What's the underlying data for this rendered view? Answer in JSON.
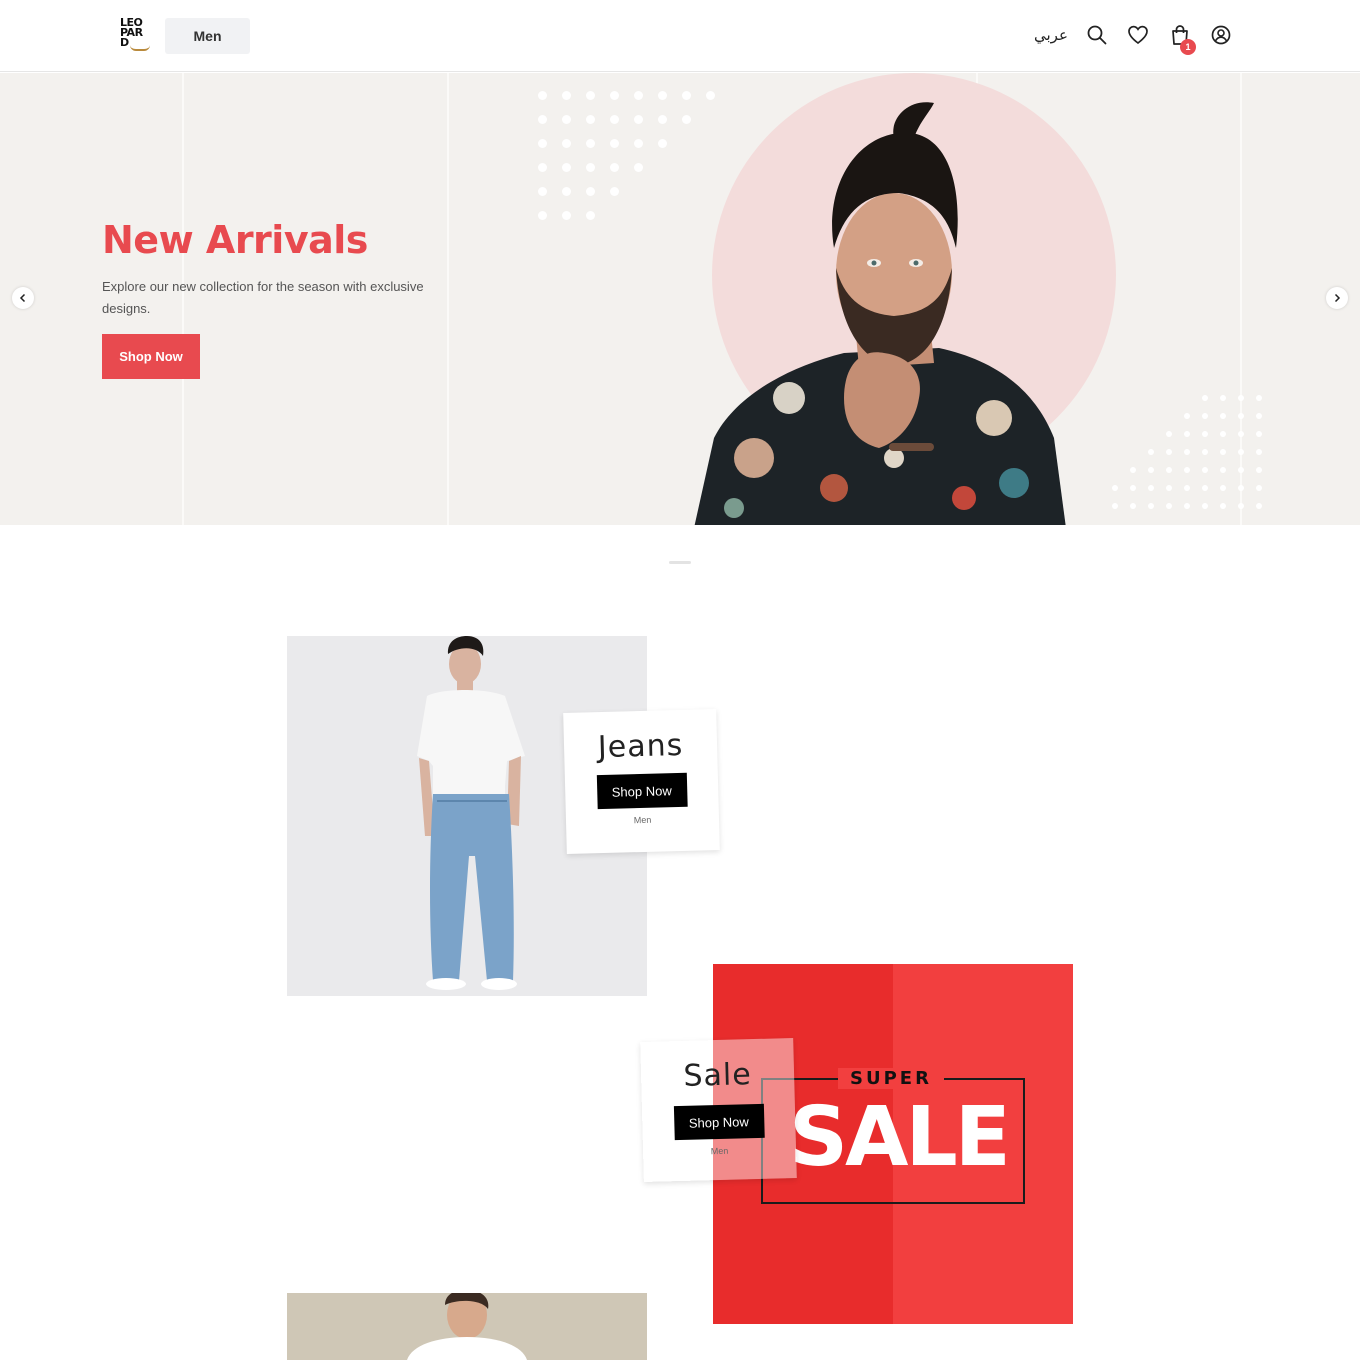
{
  "header": {
    "logo_lines": [
      "LEO",
      "PAR",
      "D"
    ],
    "nav_label": "Men",
    "lang_label": "عربي",
    "cart_count": "1",
    "icons": [
      "search-icon",
      "heart-icon",
      "bag-icon",
      "user-icon"
    ]
  },
  "hero": {
    "title": "New Arrivals",
    "subtitle": "Explore our new collection for the season with exclusive designs.",
    "button": "Shop Now",
    "prev_icon": "chevron-left-icon",
    "next_icon": "chevron-right-icon"
  },
  "tiles": [
    {
      "title": "Jeans",
      "button": "Shop Now",
      "category": "Men"
    },
    {
      "title": "Sale",
      "button": "Shop Now",
      "category": "Men"
    }
  ],
  "sale_banner": {
    "top": "SUPER",
    "main": "SALE"
  },
  "colors": {
    "accent": "#e84a4f",
    "hero_bg": "#f3f1ee",
    "sale_red": "#f23f3f",
    "button_black": "#000000"
  }
}
